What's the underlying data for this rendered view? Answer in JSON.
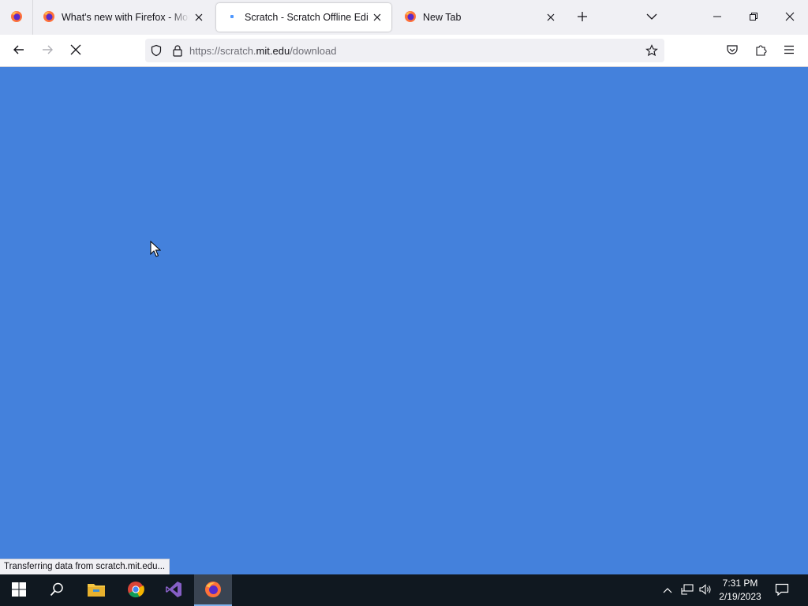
{
  "browser": {
    "tabs": [
      {
        "title": "What's new with Firefox - More"
      },
      {
        "title": "Scratch - Scratch Offline Editor"
      },
      {
        "title": "New Tab"
      }
    ],
    "url": {
      "prefix": "https://scratch.",
      "host": "mit.edu",
      "path": "/download"
    },
    "status_text": "Transferring data from scratch.mit.edu...",
    "page_background": "#4481dc"
  },
  "taskbar": {
    "apps": [
      {
        "icon": "windows-start-icon"
      },
      {
        "icon": "search-icon"
      },
      {
        "icon": "file-explorer-icon"
      },
      {
        "icon": "chrome-icon"
      },
      {
        "icon": "visual-studio-icon"
      },
      {
        "icon": "firefox-icon"
      }
    ],
    "time": "7:31 PM",
    "date": "2/19/2023"
  }
}
